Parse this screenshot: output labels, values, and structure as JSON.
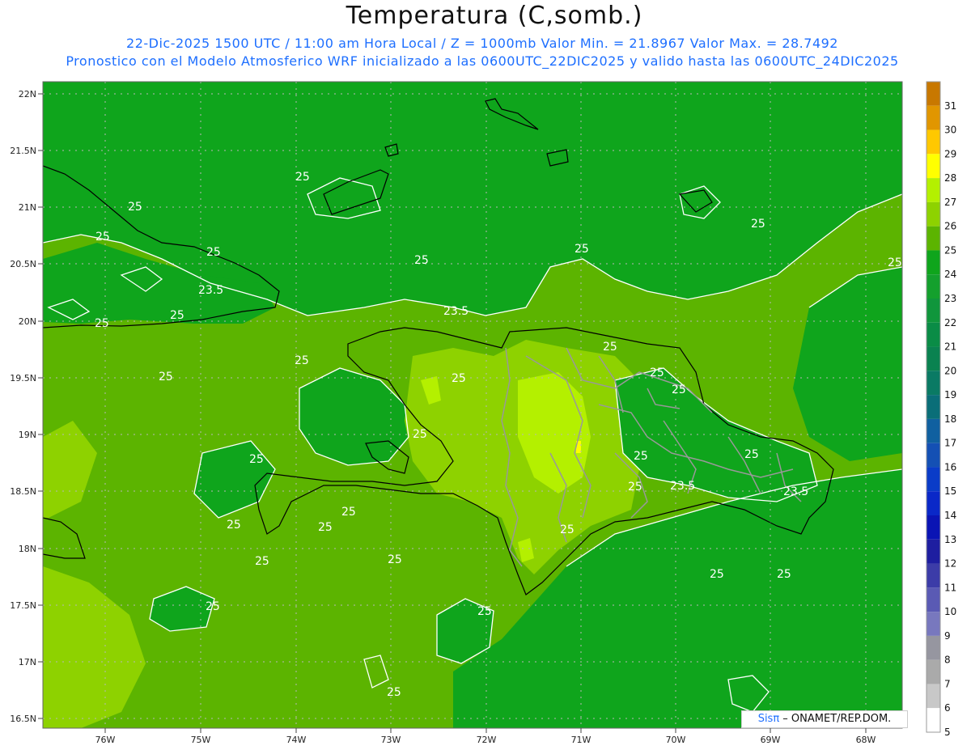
{
  "header": {
    "title": "Temperatura (C,somb.)",
    "line1": "22-Dic-2025 1500 UTC / 11:00 am Hora Local / Z = 1000mb  Valor Min. = 21.8967  Valor Max. = 28.7492",
    "line2": "Pronostico con el Modelo Atmosferico WRF inicializado a las 0600UTC_22DIC2025 y valido hasta las  0600UTC_24DIC2025"
  },
  "map": {
    "lat_labels": [
      "22N",
      "21.5N",
      "21N",
      "20.5N",
      "20N",
      "19.5N",
      "19N",
      "18.5N",
      "18N",
      "17.5N",
      "17N",
      "16.5N"
    ],
    "lon_labels": [
      "76W",
      "75W",
      "74W",
      "73W",
      "72W",
      "71W",
      "70W",
      "69W",
      "68W"
    ],
    "contour_labels": [
      "25",
      "25",
      "25",
      "25",
      "23.5",
      "25",
      "25",
      "25",
      "25",
      "23.5",
      "25",
      "25",
      "25",
      "25",
      "25",
      "25",
      "25",
      "25",
      "25",
      "25",
      "25",
      "25",
      "23.5",
      "25",
      "25",
      "25",
      "25",
      "25",
      "25",
      "25",
      "25",
      "25",
      "25",
      "25",
      "25",
      "25",
      "25",
      "25",
      "23.5",
      "25",
      "25",
      "25",
      "25"
    ],
    "colors": {
      "t23": "#0fa51c",
      "t24": "#0fa51c",
      "t25": "#5cb400",
      "t26": "#8ed200",
      "t27": "#b4f000",
      "t28": "#ffff00",
      "coast": "#000000",
      "border": "#999999",
      "contour": "#ffffff"
    }
  },
  "colorbar": {
    "levels": [
      "31",
      "30",
      "29",
      "28",
      "27",
      "26",
      "25",
      "24",
      "23",
      "22",
      "21",
      "20",
      "19",
      "18",
      "17",
      "16",
      "15",
      "14",
      "13",
      "12",
      "11",
      "10",
      "9",
      "8",
      "7",
      "6",
      "5"
    ],
    "colors": [
      "#c87800",
      "#e19600",
      "#ffc800",
      "#ffff00",
      "#b4f000",
      "#8ed200",
      "#5cb400",
      "#0fa51c",
      "#14a02d",
      "#10963c",
      "#0a8c46",
      "#0a8250",
      "#0a7a64",
      "#0a6e78",
      "#1060a0",
      "#1450b4",
      "#0a3cc8",
      "#0a28c8",
      "#0a14b4",
      "#1e1ea0",
      "#3c3ca8",
      "#5a5ab4",
      "#7878be",
      "#9696a0",
      "#aaaaaa",
      "#c8c8c8",
      "#ffffff"
    ]
  },
  "credit": {
    "brand": "Sisπ",
    "text": " – ONAMET/REP.DOM."
  }
}
